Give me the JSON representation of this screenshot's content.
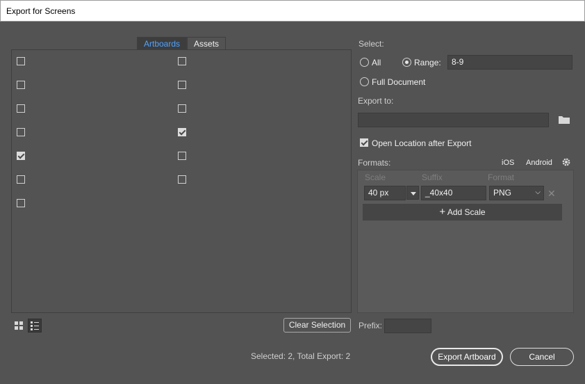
{
  "window": {
    "title": "Export for Screens"
  },
  "tabs": [
    {
      "label": "Artboards",
      "active": true
    },
    {
      "label": "Assets",
      "active": false
    }
  ],
  "artboards": {
    "column1": [
      false,
      false,
      false,
      false,
      true,
      false,
      false
    ],
    "column2": [
      false,
      false,
      false,
      true,
      false,
      false
    ]
  },
  "bottom_left": {
    "clear_selection": "Clear Selection",
    "status": "Selected: 2, Total Export: 2"
  },
  "select": {
    "label": "Select:",
    "all": "All",
    "range": "Range:",
    "range_value": "8-9",
    "full_document": "Full Document",
    "selected_option": "range"
  },
  "export_to": {
    "label": "Export to:",
    "path": "",
    "open_location_label": "Open Location after Export",
    "open_location_checked": true
  },
  "formats": {
    "label": "Formats:",
    "ios": "iOS",
    "android": "Android",
    "headers": {
      "scale": "Scale",
      "suffix": "Suffix",
      "format": "Format"
    },
    "rows": [
      {
        "scale": "40 px",
        "suffix": "_40x40",
        "format": "PNG"
      }
    ],
    "add_scale": "Add Scale"
  },
  "prefix": {
    "label": "Prefix:",
    "value": ""
  },
  "actions": {
    "export": "Export Artboard",
    "cancel": "Cancel"
  },
  "icons": [
    "folder-icon",
    "gear-icon",
    "grid-view-icon",
    "list-view-icon",
    "remove-icon",
    "plus-icon"
  ]
}
